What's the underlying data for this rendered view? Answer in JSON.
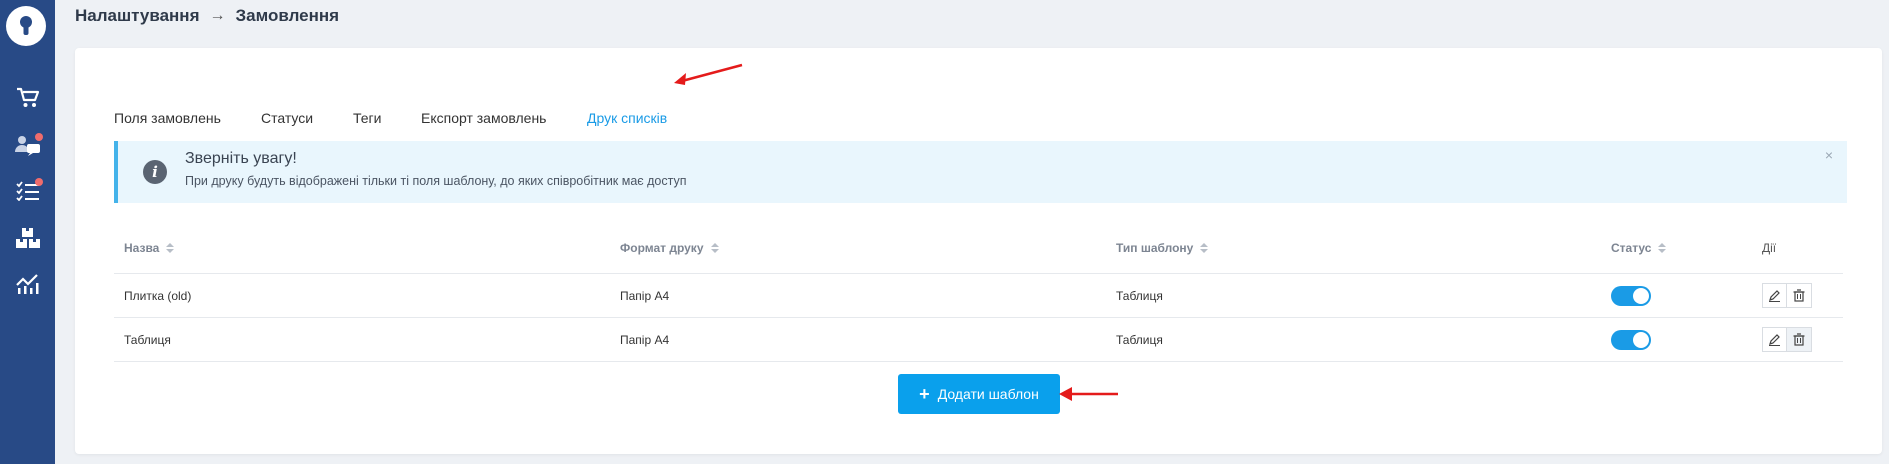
{
  "breadcrumb": {
    "parent": "Налаштування",
    "separator": "→",
    "current": "Замовлення"
  },
  "sidebar": {
    "logo_icon": "key-icon",
    "items": [
      {
        "icon": "cart-icon",
        "badge": false
      },
      {
        "icon": "users-chat-icon",
        "badge": true
      },
      {
        "icon": "checklist-icon",
        "badge": true
      },
      {
        "icon": "boxes-icon",
        "badge": false
      },
      {
        "icon": "analytics-icon",
        "badge": false
      }
    ]
  },
  "tabs": [
    {
      "label": "Поля замовлень",
      "active": false
    },
    {
      "label": "Статуси",
      "active": false
    },
    {
      "label": "Теги",
      "active": false
    },
    {
      "label": "Експорт замовлень",
      "active": false
    },
    {
      "label": "Друк списків",
      "active": true
    }
  ],
  "alert": {
    "icon": "info-icon",
    "title": "Зверніть увагу!",
    "text": "При друку будуть відображені тільки ті поля шаблону, до яких співробітник має доступ",
    "close": "×"
  },
  "table": {
    "columns": [
      "Назва",
      "Формат друку",
      "Тип шаблону",
      "Статус",
      "Дії"
    ],
    "rows": [
      {
        "name": "Плитка (old)",
        "format": "Папір А4",
        "type": "Таблиця",
        "status_on": true
      },
      {
        "name": "Таблиця",
        "format": "Папір А4",
        "type": "Таблиця",
        "status_on": true
      }
    ]
  },
  "add_button": {
    "icon": "+",
    "label": "Додати шаблон"
  },
  "colors": {
    "sidebar": "#284a86",
    "accent": "#1a9be6",
    "button": "#0aa0ec",
    "annotation_arrow": "#e41b1b"
  }
}
